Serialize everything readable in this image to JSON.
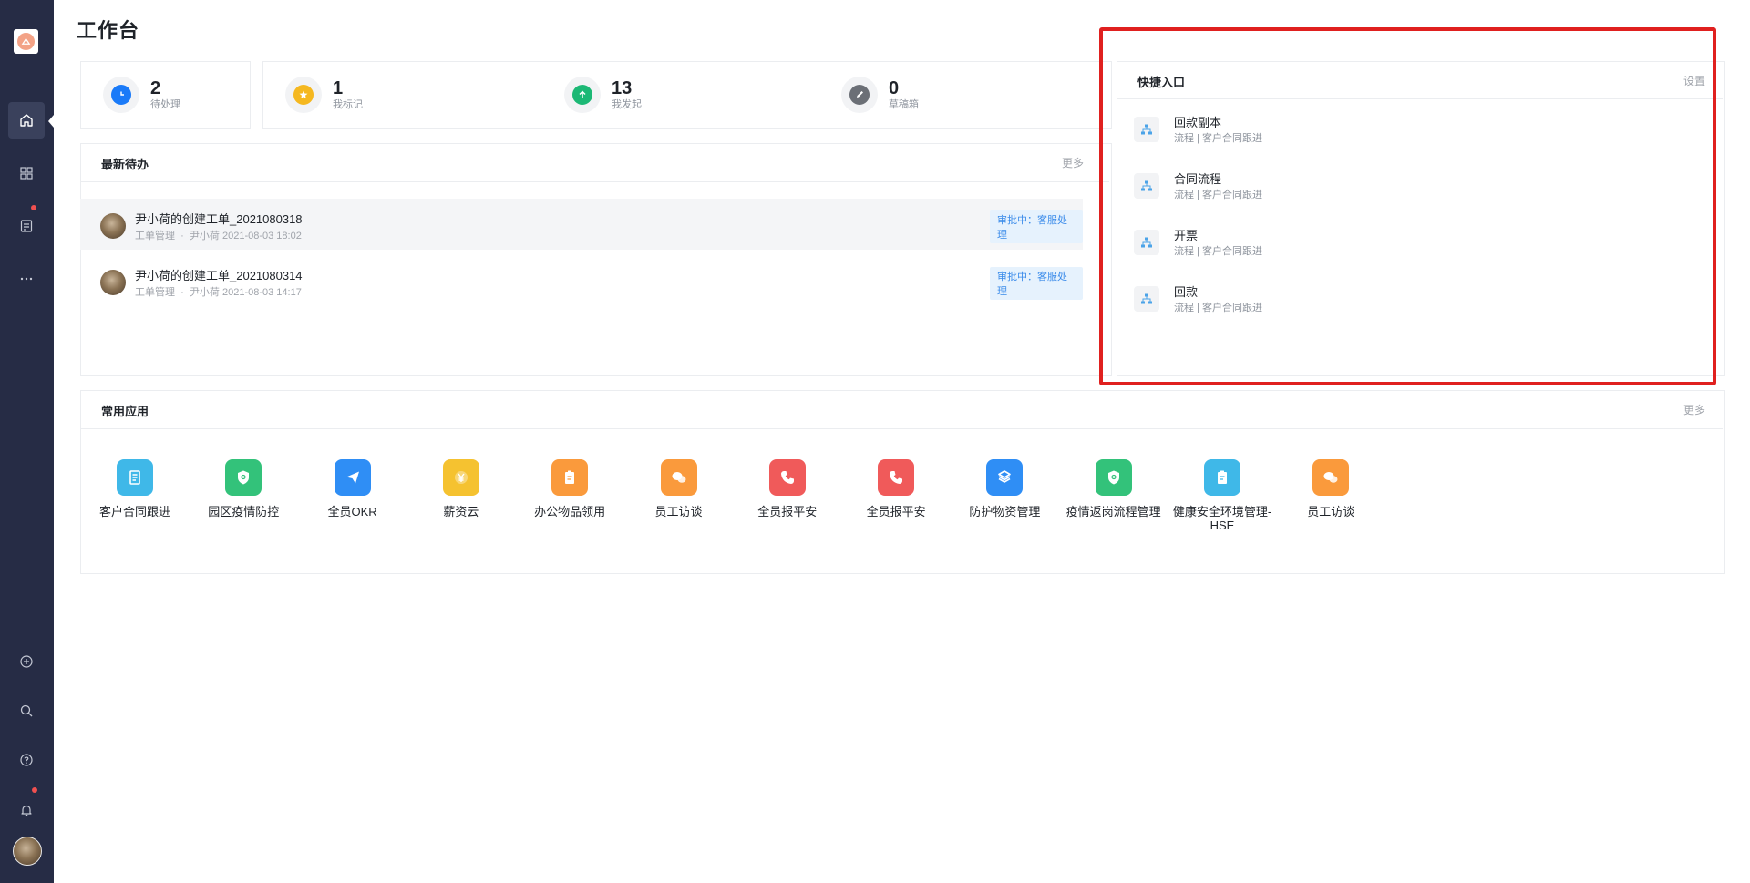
{
  "page": {
    "title": "工作台"
  },
  "stats": [
    {
      "value": "2",
      "label": "待处理",
      "color": "#1a7af8"
    },
    {
      "value": "1",
      "label": "我标记",
      "color": "#f5b820"
    },
    {
      "value": "13",
      "label": "我发起",
      "color": "#1cb875"
    },
    {
      "value": "0",
      "label": "草稿箱",
      "color": "#6b6f76"
    }
  ],
  "todo": {
    "title": "最新待办",
    "more": "更多",
    "items": [
      {
        "title": "尹小荷的创建工单_2021080318",
        "category": "工单管理",
        "sep": "·",
        "author": "尹小荷",
        "time": "2021-08-03 18:02",
        "status": "审批中：客服处理"
      },
      {
        "title": "尹小荷的创建工单_2021080314",
        "category": "工单管理",
        "sep": "·",
        "author": "尹小荷",
        "time": "2021-08-03 14:17",
        "status": "审批中：客服处理"
      }
    ]
  },
  "quick_entry": {
    "title": "快捷入口",
    "settings": "设置",
    "items": [
      {
        "title": "回款副本",
        "sub": "流程 | 客户合同跟进"
      },
      {
        "title": "合同流程",
        "sub": "流程 | 客户合同跟进"
      },
      {
        "title": "开票",
        "sub": "流程 | 客户合同跟进"
      },
      {
        "title": "回款",
        "sub": "流程 | 客户合同跟进"
      }
    ]
  },
  "apps": {
    "title": "常用应用",
    "more": "更多",
    "items": [
      {
        "label": "客户合同跟进",
        "color": "#3fb8e8",
        "icon": "document-icon"
      },
      {
        "label": "园区疫情防控",
        "color": "#33c27a",
        "icon": "shield-icon"
      },
      {
        "label": "全员OKR",
        "color": "#2f8ef5",
        "icon": "paper-plane-icon"
      },
      {
        "label": "薪资云",
        "color": "#f5c230",
        "icon": "yen-icon"
      },
      {
        "label": "办公物品领用",
        "color": "#fa9a3c",
        "icon": "clipboard-icon"
      },
      {
        "label": "员工访谈",
        "color": "#fa9a3c",
        "icon": "chat-icon"
      },
      {
        "label": "全员报平安",
        "color": "#f05a5a",
        "icon": "phone-icon"
      },
      {
        "label": "全员报平安",
        "color": "#f05a5a",
        "icon": "phone-icon"
      },
      {
        "label": "防护物资管理",
        "color": "#2f8ef5",
        "icon": "box-icon"
      },
      {
        "label": "疫情返岗流程管理",
        "color": "#33c27a",
        "icon": "shield-icon"
      },
      {
        "label": "健康安全环境管理-HSE",
        "color": "#3fb8e8",
        "icon": "clipboard-icon"
      },
      {
        "label": "员工访谈",
        "color": "#fa9a3c",
        "icon": "chat-icon"
      }
    ]
  }
}
